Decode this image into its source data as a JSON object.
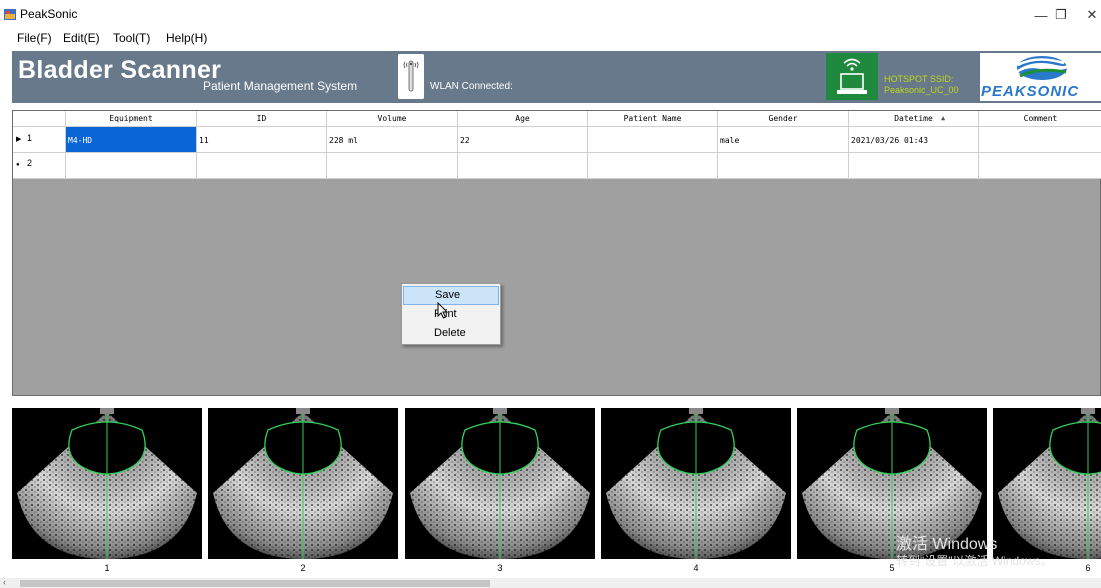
{
  "window": {
    "title": "PeakSonic"
  },
  "window_controls": {
    "minimize": "—",
    "restore": "❐",
    "close": "✕"
  },
  "menu": [
    "File(F)",
    "Edit(E)",
    "Tool(T)",
    "Help(H)"
  ],
  "header": {
    "title": "Bladder Scanner",
    "subtitle": "Patient Management System",
    "wlan_status": "WLAN Connected:",
    "hotspot_label": "HOTSPOT SSID:",
    "hotspot_ssid": "Peaksonic_UC_00",
    "logo_text": "PEAKSONIC"
  },
  "table": {
    "columns": [
      "Equipment",
      "ID",
      "Volume",
      "Age",
      "Patient Name",
      "Gender",
      "Datetime",
      "Comment"
    ],
    "sort_indicator": "▲",
    "rows": [
      {
        "row_marker": "▶",
        "num": "1",
        "cells": [
          "M4-HD",
          "11",
          "228 ml",
          "22",
          "",
          "male",
          "2021/03/26 01:43",
          ""
        ]
      },
      {
        "row_marker": "●",
        "num": "2",
        "cells": [
          "",
          "",
          "",
          "",
          "",
          "",
          "",
          ""
        ]
      }
    ]
  },
  "context_menu": {
    "items": [
      "Save",
      "Print",
      "Delete"
    ],
    "highlighted": "Save"
  },
  "thumbnails": [
    "1",
    "2",
    "3",
    "4",
    "5",
    "6"
  ],
  "watermark": {
    "line1": "激活 Windows",
    "line2": "转到\"设置\"以激活 Windows。"
  },
  "colors": {
    "banner": "#67798a",
    "selected": "#0a66d6",
    "hotspot": "#1f8a3e",
    "outline": "#2fd05a"
  }
}
